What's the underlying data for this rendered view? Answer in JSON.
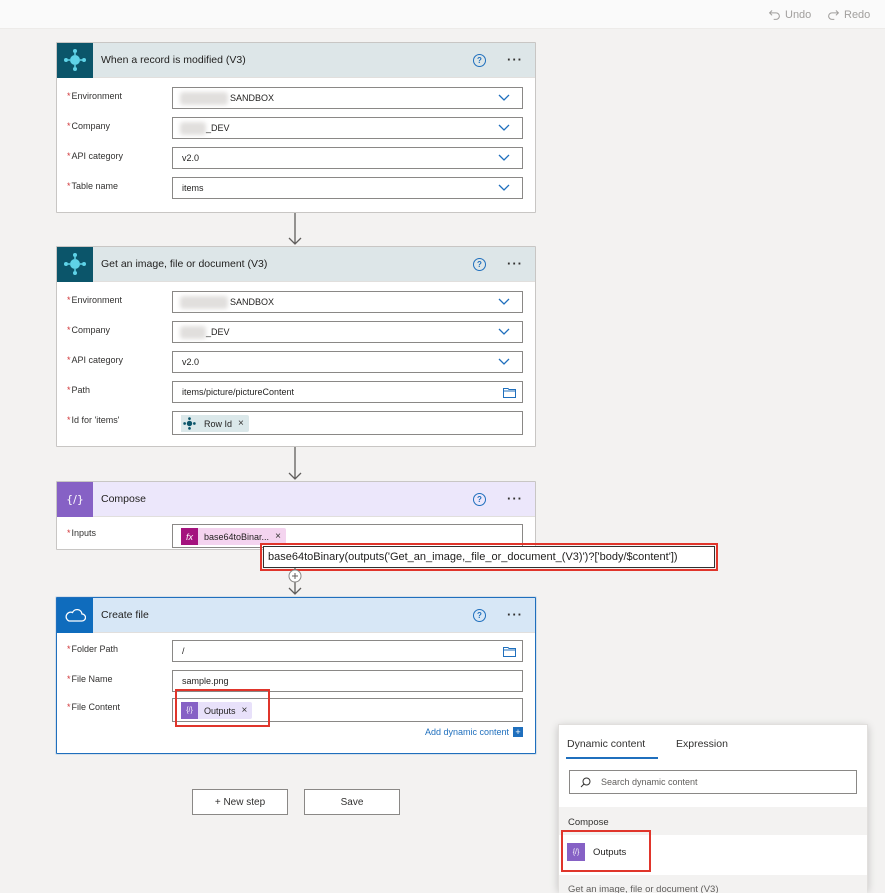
{
  "toolbar": {
    "undo": "Undo",
    "redo": "Redo"
  },
  "cards": {
    "trigger": {
      "title": "When a record is modified (V3)",
      "fields": [
        {
          "label": "Environment",
          "value": "SANDBOX"
        },
        {
          "label": "Company",
          "value": "_DEV"
        },
        {
          "label": "API category",
          "value": "v2.0"
        },
        {
          "label": "Table name",
          "value": "items"
        }
      ]
    },
    "get_image": {
      "title": "Get an image, file or document (V3)",
      "fields": [
        {
          "label": "Environment",
          "value": "SANDBOX"
        },
        {
          "label": "Company",
          "value": "_DEV"
        },
        {
          "label": "API category",
          "value": "v2.0"
        },
        {
          "label": "Path",
          "value": "items/picture/pictureContent"
        },
        {
          "label": "Id for 'items'",
          "token": "Row Id"
        }
      ]
    },
    "compose": {
      "title": "Compose",
      "fields": [
        {
          "label": "Inputs",
          "token": "base64toBinar..."
        }
      ]
    },
    "create_file": {
      "title": "Create file",
      "fields": [
        {
          "label": "Folder Path",
          "value": "/"
        },
        {
          "label": "File Name",
          "value": "sample.png"
        },
        {
          "label": "File Content",
          "token": "Outputs"
        }
      ],
      "add_dynamic": "Add dynamic content"
    }
  },
  "tooltip": "base64toBinary(outputs('Get_an_image,_file_or_document_(V3)')?['body/$content'])",
  "buttons": {
    "new_step": "+ New step",
    "save": "Save"
  },
  "dynamic_panel": {
    "tabs": [
      "Dynamic content",
      "Expression"
    ],
    "search_placeholder": "Search dynamic content",
    "section": "Compose",
    "item": "Outputs",
    "next_section": "Get an image, file or document (V3)"
  },
  "colors": {
    "bc_header": "#dde6e8",
    "bc_icon": "#0b556a",
    "compose_header": "#ece7fb",
    "compose_icon": "#8661c5",
    "onedrive_header": "#d7e7f6",
    "onedrive_icon": "#0f6cbd",
    "fx_token": "#f4d4ef",
    "fx_icon": "#a4137e",
    "highlight": "#e0352b",
    "link": "#1f6fbd"
  }
}
